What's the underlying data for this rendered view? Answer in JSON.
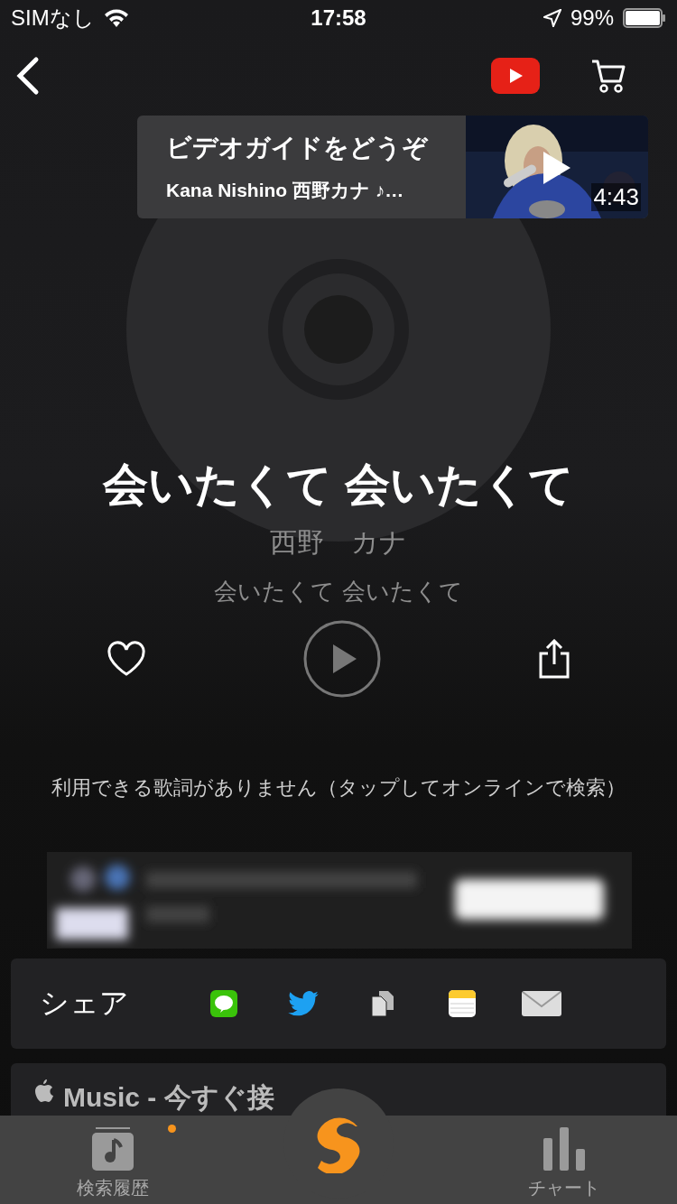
{
  "status_bar": {
    "carrier": "SIMなし",
    "time": "17:58",
    "battery": "99%"
  },
  "video_guide": {
    "title": "ビデオガイドをどうぞ",
    "subtitle": "Kana Nishino 西野カナ ♪…",
    "duration": "4:43"
  },
  "song": {
    "title": "会いたくて 会いたくて",
    "artist": "西野　カナ",
    "album": "会いたくて 会いたくて",
    "liked": false
  },
  "lyrics_notice": "利用できる歌詞がありません（タップしてオンラインで検索）",
  "share": {
    "label": "シェア",
    "targets": [
      {
        "kind": "line"
      },
      {
        "kind": "twitter"
      },
      {
        "kind": "copy"
      },
      {
        "kind": "notes"
      },
      {
        "kind": "mail"
      }
    ]
  },
  "music_card": {
    "title": "Music - 今すぐ接"
  },
  "tabs": [
    {
      "kind": "history",
      "label": "検索履歴",
      "badge": true
    },
    {
      "kind": "shazam"
    },
    {
      "kind": "chart",
      "label": "チャート",
      "badge": false
    }
  ]
}
